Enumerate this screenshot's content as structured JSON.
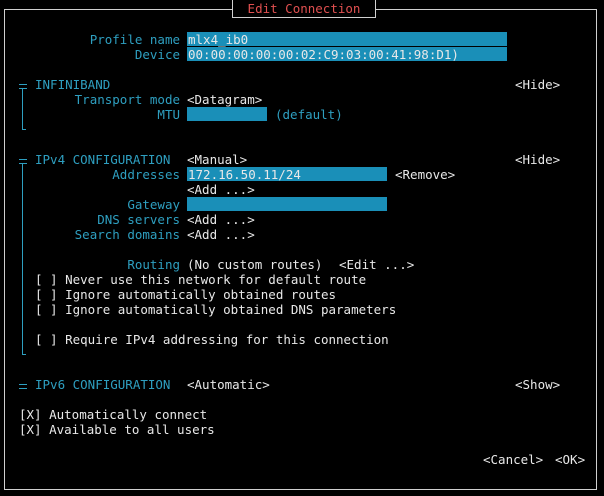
{
  "dialog": {
    "title": "Edit Connection"
  },
  "profile": {
    "name_label": "Profile name",
    "name_value": "mlx4_ib0",
    "device_label": "Device",
    "device_value": "00:00:00:00:00:02:C9:03:00:41:98:D1)"
  },
  "infiniband": {
    "header": "INFINIBAND",
    "hide_label": "<Hide>",
    "transport_label": "Transport mode",
    "transport_value": "<Datagram>",
    "mtu_label": "MTU",
    "mtu_value": "",
    "mtu_default": "(default)"
  },
  "ipv4": {
    "header": "IPv4 CONFIGURATION",
    "method": "<Manual>",
    "hide_label": "<Hide>",
    "addresses_label": "Addresses",
    "address_value": "172.16.50.11/24",
    "remove_label": "<Remove>",
    "add_address_label": "<Add ...>",
    "gateway_label": "Gateway",
    "gateway_value": "",
    "dns_label": "DNS servers",
    "dns_add_label": "<Add ...>",
    "search_label": "Search domains",
    "search_add_label": "<Add ...>",
    "routing_label": "Routing",
    "routing_value": "(No custom routes)",
    "routing_edit_label": "<Edit ...>",
    "opt_never_default": "[ ] Never use this network for default route",
    "opt_ignore_routes": "[ ] Ignore automatically obtained routes",
    "opt_ignore_dns": "[ ] Ignore automatically obtained DNS parameters",
    "opt_require_ipv4": "[ ] Require IPv4 addressing for this connection"
  },
  "ipv6": {
    "header": "IPv6 CONFIGURATION",
    "method": "<Automatic>",
    "show_label": "<Show>"
  },
  "options": {
    "auto_connect": "[X] Automatically connect",
    "all_users": "[X] Available to all users"
  },
  "buttons": {
    "cancel": "<Cancel>",
    "ok": "<OK>"
  },
  "colors": {
    "background": "#000000",
    "label": "#2e9fc0",
    "field": "#1a8fb8",
    "title": "#e05050",
    "text": "#e8e8e8"
  }
}
